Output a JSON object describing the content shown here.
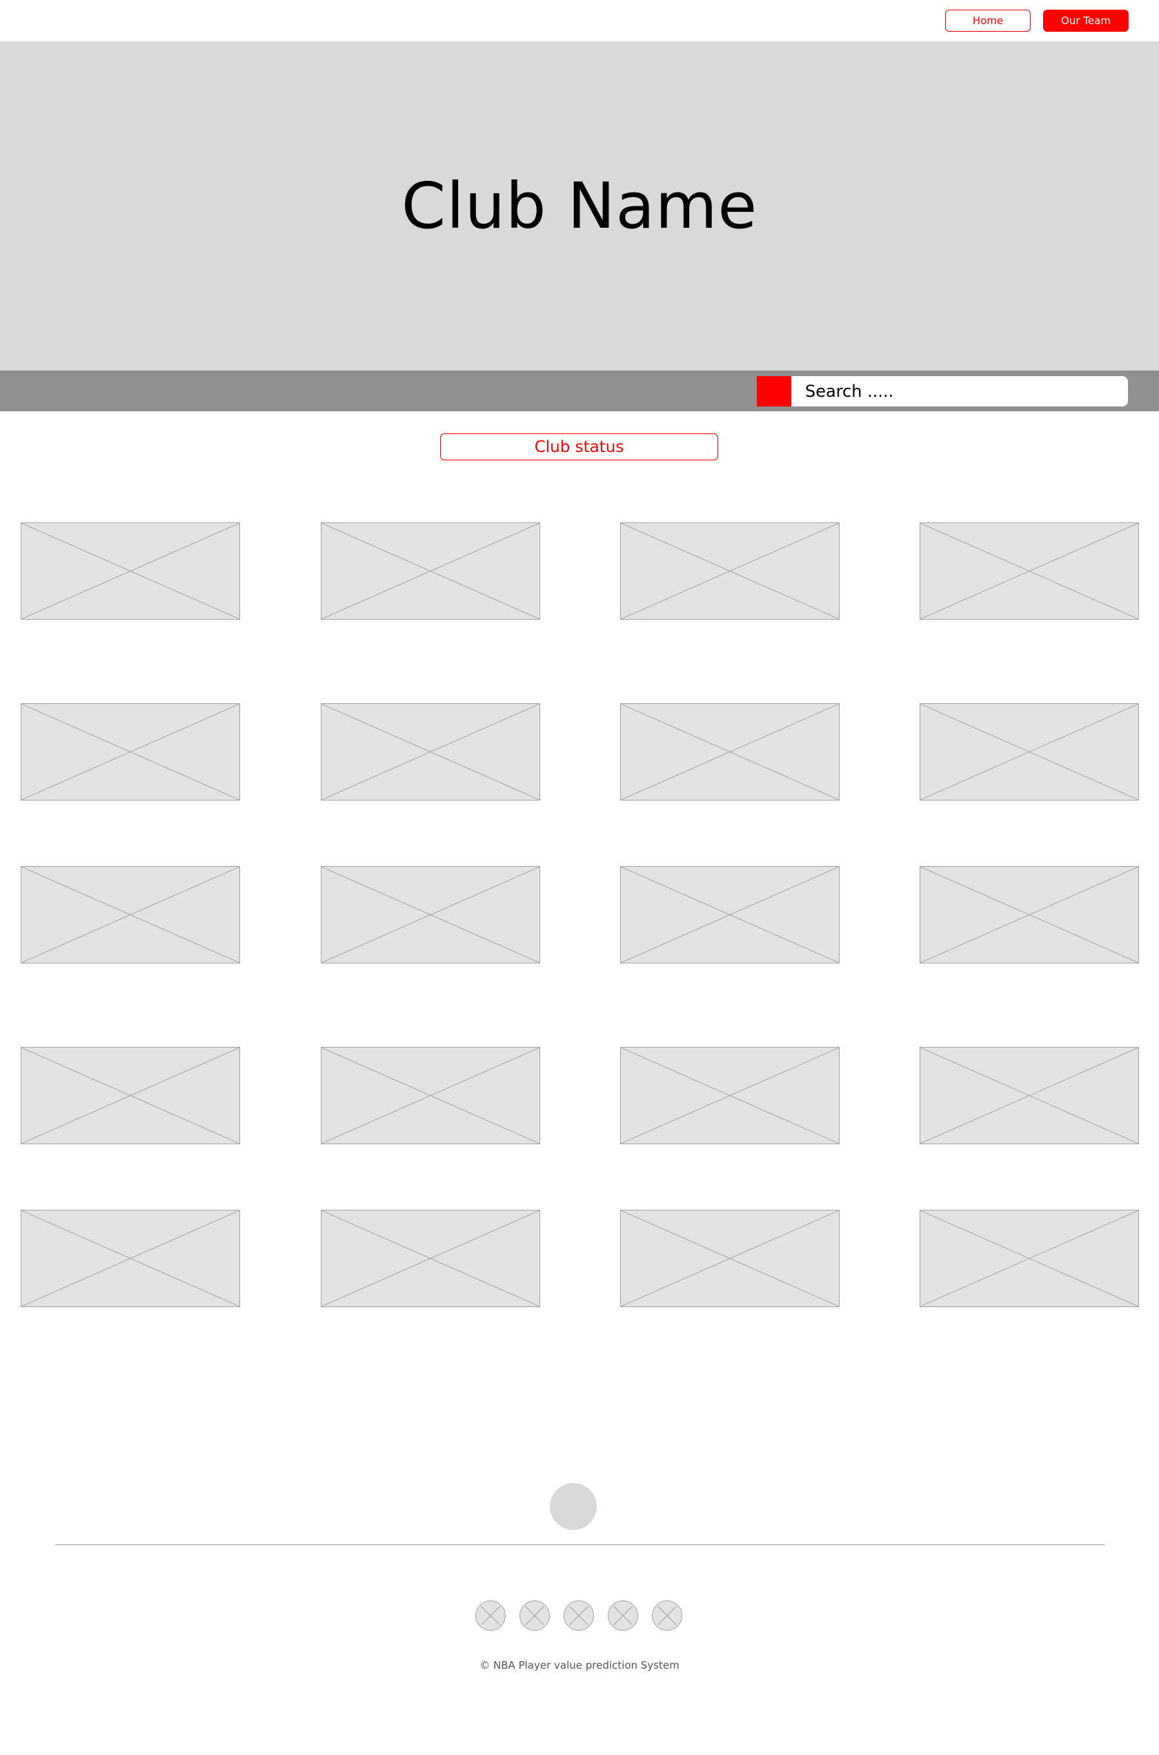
{
  "nav": {
    "home_label": "Home",
    "team_label": "Our Team"
  },
  "hero": {
    "title": "Club Name"
  },
  "search": {
    "placeholder": "Search ....."
  },
  "status": {
    "label": "Club status"
  },
  "player_grid": {
    "rows": 5,
    "columns": 4,
    "placeholder_icon": "image-placeholder-icon"
  },
  "footer": {
    "avatar_icon": "avatar",
    "social_icons": [
      "social-icon-1",
      "social-icon-2",
      "social-icon-3",
      "social-icon-4",
      "social-icon-5"
    ],
    "copyright": "© NBA Player value prediction System"
  },
  "colors": {
    "accent": "#ff0000",
    "hero_bg": "#d9d9d9",
    "search_strip_bg": "#918f8f",
    "placeholder_bg": "#e3e3e3"
  }
}
